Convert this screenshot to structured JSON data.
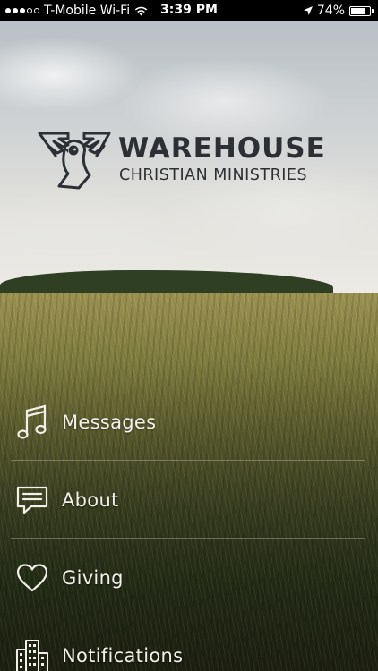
{
  "status_bar": {
    "carrier": "T-Mobile Wi-Fi",
    "time": "3:39 PM",
    "battery_percent": "74%",
    "battery_level": 0.74,
    "signal_dots_filled": 3,
    "signal_dots_total": 5,
    "icons": [
      "signal-dots-icon",
      "wifi-icon",
      "location-arrow-icon",
      "battery-icon"
    ]
  },
  "logo": {
    "title": "WAREHOUSE",
    "subtitle": "CHRISTIAN MINISTRIES",
    "icon": "dove-icon",
    "text_color": "#2c2f33"
  },
  "menu": {
    "items": [
      {
        "label": "Messages",
        "icon": "music-note-icon"
      },
      {
        "label": "About",
        "icon": "speech-bubble-icon"
      },
      {
        "label": "Giving",
        "icon": "heart-icon"
      },
      {
        "label": "Notifications",
        "icon": "buildings-icon"
      }
    ],
    "label_color": "#f2f0e8"
  }
}
